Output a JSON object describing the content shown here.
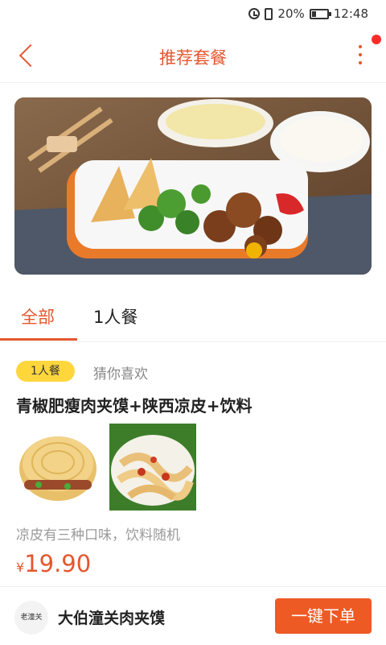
{
  "status_bar": {
    "battery_percent": "20%",
    "time": "12:48",
    "icons": [
      "alarm-icon",
      "vibrate-icon",
      "battery-icon"
    ]
  },
  "header": {
    "title": "推荐套餐",
    "back_icon": "chevron-left-icon",
    "more_icon": "more-vertical-icon",
    "has_notification_dot": true
  },
  "tabs": [
    {
      "label": "全部",
      "active": true
    },
    {
      "label": "1人餐",
      "active": false
    }
  ],
  "item": {
    "badge": "1人餐",
    "tagline": "猜你喜欢",
    "title": "青椒肥瘦肉夹馍+陕西凉皮+饮料",
    "description": "凉皮有三种口味，饮料随机",
    "price_symbol": "¥",
    "price": "19.90"
  },
  "bottom_bar": {
    "shop_logo_text": "老潼关",
    "shop_name": "大伯潼关肉夹馍",
    "order_button": "一键下单"
  },
  "colors": {
    "accent": "#e4572e",
    "order_button": "#ee5a24",
    "badge": "#ffd63c",
    "notification_dot": "#ff2b2b"
  }
}
